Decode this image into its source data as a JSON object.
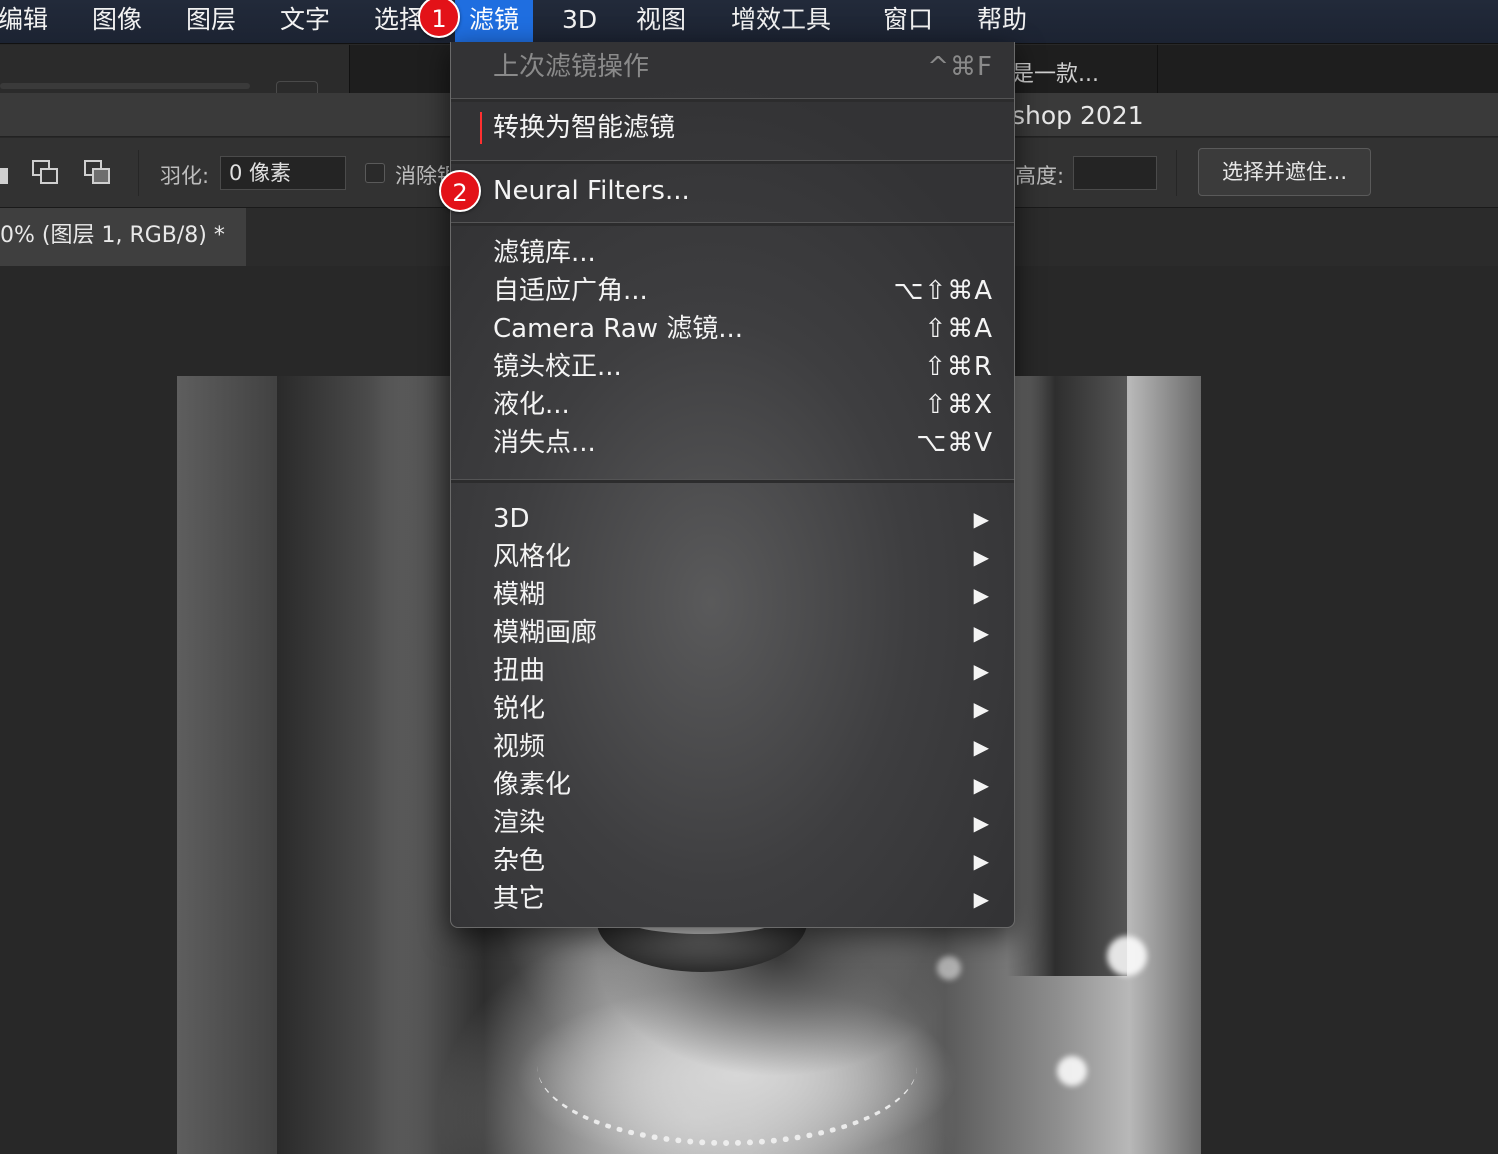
{
  "menubar": {
    "items": [
      {
        "label": "编辑"
      },
      {
        "label": "图像"
      },
      {
        "label": "图层"
      },
      {
        "label": "文字"
      },
      {
        "label": "选择"
      },
      {
        "label": "滤镜"
      },
      {
        "label": "3D"
      },
      {
        "label": "视图"
      },
      {
        "label": "增效工具"
      },
      {
        "label": "窗口"
      },
      {
        "label": "帮助"
      }
    ],
    "active_index": 5
  },
  "window": {
    "doc_snippet": "是一款...",
    "title_suffix": "shop 2021"
  },
  "options_bar": {
    "feather_label": "羽化:",
    "feather_value": "0 像素",
    "antialias_label": "消除锯齿",
    "height_label": "高度:",
    "height_value": "",
    "select_mask_button": "选择并遮住..."
  },
  "document_tab": {
    "label": "0% (图层 1, RGB/8) *"
  },
  "filter_menu": {
    "last_filter": {
      "label": "上次滤镜操作",
      "shortcut": "^⌘F",
      "enabled": false
    },
    "convert_smart": {
      "label": "转换为智能滤镜"
    },
    "neural_filters": {
      "label": "Neural Filters..."
    },
    "group1": [
      {
        "label": "滤镜库...",
        "shortcut": ""
      },
      {
        "label": "自适应广角...",
        "shortcut": "⌥⇧⌘A"
      },
      {
        "label": "Camera Raw 滤镜...",
        "shortcut": "⇧⌘A"
      },
      {
        "label": "镜头校正...",
        "shortcut": "⇧⌘R"
      },
      {
        "label": "液化...",
        "shortcut": "⇧⌘X"
      },
      {
        "label": "消失点...",
        "shortcut": "⌥⌘V"
      }
    ],
    "submenus": [
      {
        "label": "3D"
      },
      {
        "label": "风格化"
      },
      {
        "label": "模糊"
      },
      {
        "label": "模糊画廊"
      },
      {
        "label": "扭曲"
      },
      {
        "label": "锐化"
      },
      {
        "label": "视频"
      },
      {
        "label": "像素化"
      },
      {
        "label": "渲染"
      },
      {
        "label": "杂色"
      },
      {
        "label": "其它"
      }
    ],
    "submenu_arrow": "▶"
  },
  "annotations": {
    "step1": "1",
    "step2": "2"
  },
  "colors": {
    "menu_highlight": "#1f6ee0",
    "badge": "#e31218",
    "caret": "#ff3030"
  }
}
